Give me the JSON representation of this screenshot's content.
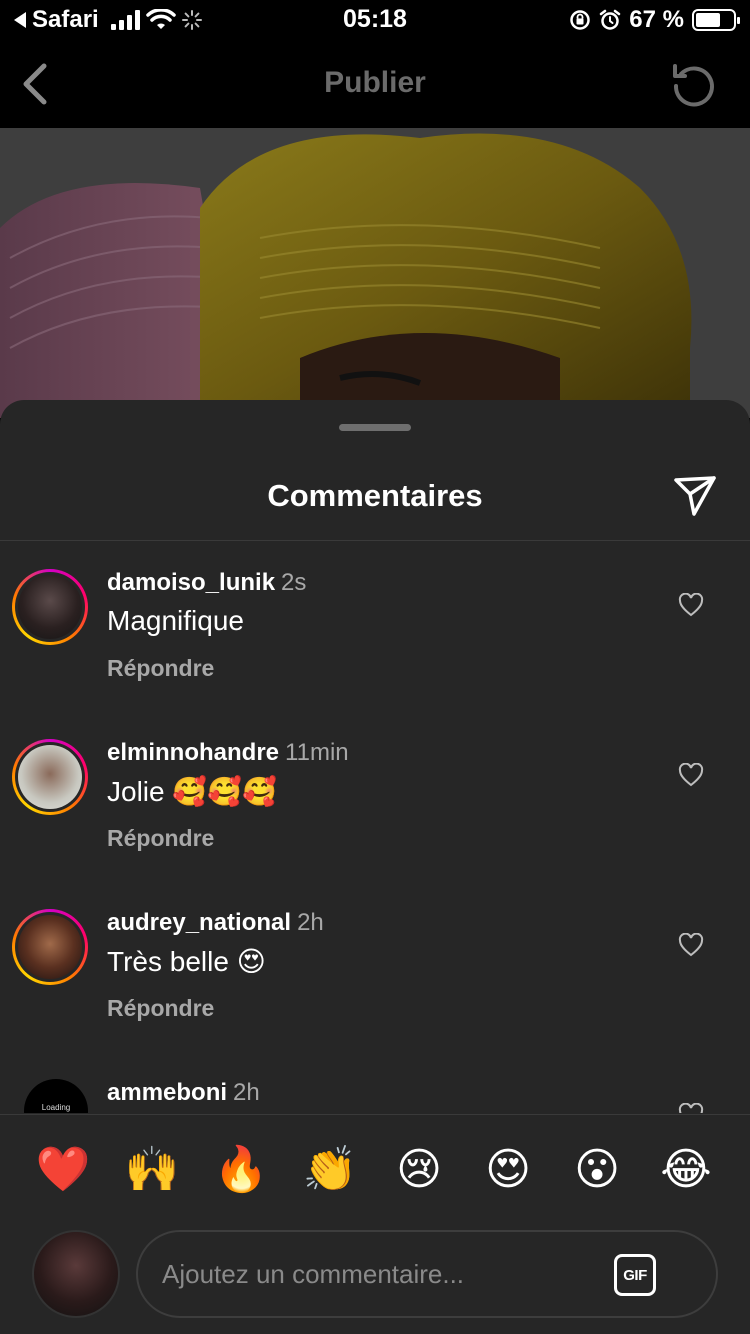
{
  "status_bar": {
    "back_app": "Safari",
    "time": "05:18",
    "battery": "67 %",
    "battery_level": 0.67
  },
  "nav": {
    "title": "Publier"
  },
  "sheet": {
    "title": "Commentaires"
  },
  "comments": [
    {
      "user": "damoiso_lunik",
      "time": "2s",
      "text": "Magnifique",
      "reply_label": "Répondre"
    },
    {
      "user": "elminnohandre",
      "time": "11min",
      "text": "Jolie 🥰🥰🥰",
      "reply_label": "Répondre"
    },
    {
      "user": "audrey_national",
      "time": "2h",
      "text": "Très belle 😍",
      "reply_label": "Répondre"
    },
    {
      "user": "ammeboni",
      "time": "2h",
      "avatar_text": "Loading"
    }
  ],
  "quick_reactions": [
    "❤️",
    "🙌",
    "🔥",
    "👏",
    "😢",
    "😍",
    "😮",
    "😂"
  ],
  "composer": {
    "placeholder": "Ajoutez un commentaire...",
    "gif_label": "GIF"
  }
}
